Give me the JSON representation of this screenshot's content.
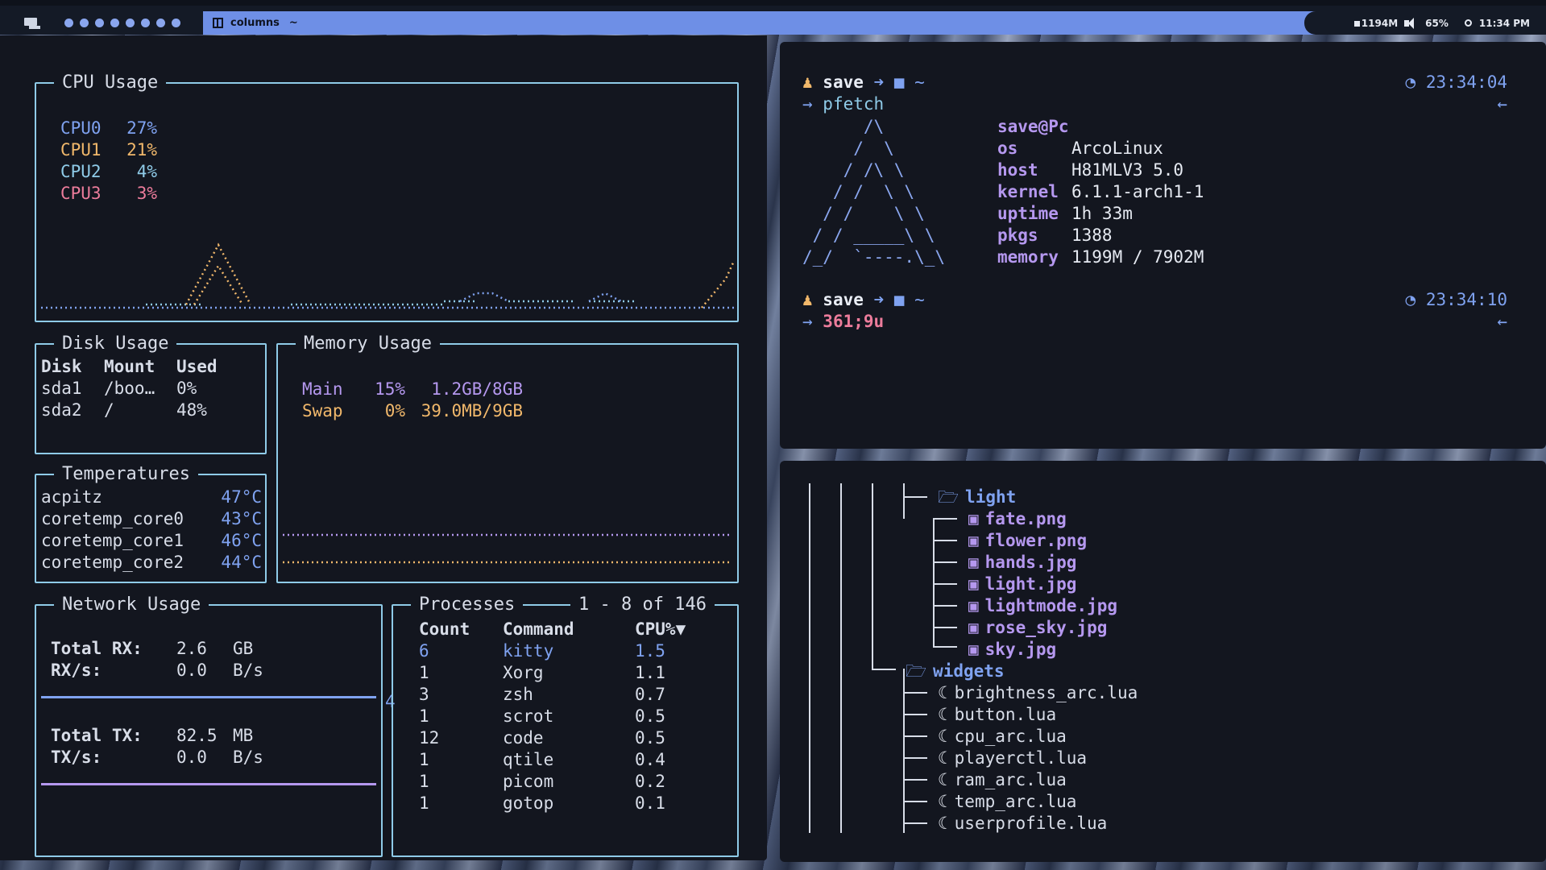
{
  "bar": {
    "groups": [
      "1",
      "2",
      "3",
      "4",
      "5",
      "6",
      "7",
      "8"
    ],
    "layout": "columns",
    "prompt": "~",
    "memory": "1194M",
    "volume": "65%",
    "time": "11:34 PM",
    "accent": "#6e8fe6"
  },
  "cpu": {
    "title": "CPU Usage",
    "cores": [
      {
        "name": "CPU0",
        "value": "27%",
        "color": "#7fa2f0"
      },
      {
        "name": "CPU1",
        "value": "21%",
        "color": "#f1b86b"
      },
      {
        "name": "CPU2",
        "value": "4%",
        "color": "#8fcbe8"
      },
      {
        "name": "CPU3",
        "value": "3%",
        "color": "#ec7c9b"
      }
    ]
  },
  "disk": {
    "title": "Disk Usage",
    "headers": [
      "Disk",
      "Mount",
      "Used"
    ],
    "rows": [
      [
        "sda1",
        "/boo…",
        "0%"
      ],
      [
        "sda2",
        "/",
        "48%"
      ]
    ]
  },
  "temps": {
    "title": "Temperatures",
    "rows": [
      {
        "name": "acpitz",
        "value": "47°C"
      },
      {
        "name": "coretemp_core0",
        "value": "43°C"
      },
      {
        "name": "coretemp_core1",
        "value": "46°C"
      },
      {
        "name": "coretemp_core2",
        "value": "44°C"
      }
    ]
  },
  "memory": {
    "title": "Memory Usage",
    "rows": [
      {
        "name": "Main",
        "pct": "15%",
        "amount": "1.2GB/8GB",
        "color": "#b598ef"
      },
      {
        "name": "Swap",
        "pct": "0%",
        "amount": "39.0MB/9GB",
        "color": "#f1b86b"
      }
    ]
  },
  "network": {
    "title": "Network Usage",
    "rx": {
      "total_label": "Total RX:",
      "total_value": "2.6",
      "total_unit": "GB",
      "rate_label": "RX/s:",
      "rate_value": "0.0",
      "rate_unit": "B/s"
    },
    "tx": {
      "total_label": "Total TX:",
      "total_value": "82.5",
      "total_unit": "MB",
      "rate_label": "TX/s:",
      "rate_value": "0.0",
      "rate_unit": "B/s"
    }
  },
  "processes": {
    "title": "Processes",
    "range": "1 - 8 of 146",
    "headers": [
      "Count",
      "Command",
      "CPU%▼"
    ],
    "side_label": "4",
    "rows": [
      [
        "6",
        "kitty",
        "1.5"
      ],
      [
        "1",
        "Xorg",
        "1.1"
      ],
      [
        "3",
        "zsh",
        "0.7"
      ],
      [
        "1",
        "scrot",
        "0.5"
      ],
      [
        "12",
        "code",
        "0.5"
      ],
      [
        "1",
        "qtile",
        "0.4"
      ],
      [
        "1",
        "picom",
        "0.2"
      ],
      [
        "1",
        "gotop",
        "0.1"
      ]
    ]
  },
  "terminal": {
    "prompt1": {
      "user": "save",
      "dir": "~",
      "time": "23:34:04",
      "command": "pfetch"
    },
    "pfetch": {
      "title": "save@Pc",
      "rows": [
        {
          "k": "os",
          "v": "ArcoLinux"
        },
        {
          "k": "host",
          "v": "H81MLV3 5.0"
        },
        {
          "k": "kernel",
          "v": "6.1.1-arch1-1"
        },
        {
          "k": "uptime",
          "v": "1h 33m"
        },
        {
          "k": "pkgs",
          "v": "1388"
        },
        {
          "k": "memory",
          "v": "1199M / 7902M"
        }
      ]
    },
    "prompt2": {
      "user": "save",
      "dir": "~",
      "time": "23:34:10",
      "command": "361;9u"
    }
  },
  "tree": {
    "folder1": "light",
    "images": [
      "fate.png",
      "flower.png",
      "hands.jpg",
      "light.jpg",
      "lightmode.jpg",
      "rose_sky.jpg",
      "sky.jpg"
    ],
    "folder2": "widgets",
    "lua": [
      "brightness_arc.lua",
      "button.lua",
      "cpu_arc.lua",
      "playerctl.lua",
      "ram_arc.lua",
      "temp_arc.lua",
      "userprofile.lua"
    ]
  }
}
